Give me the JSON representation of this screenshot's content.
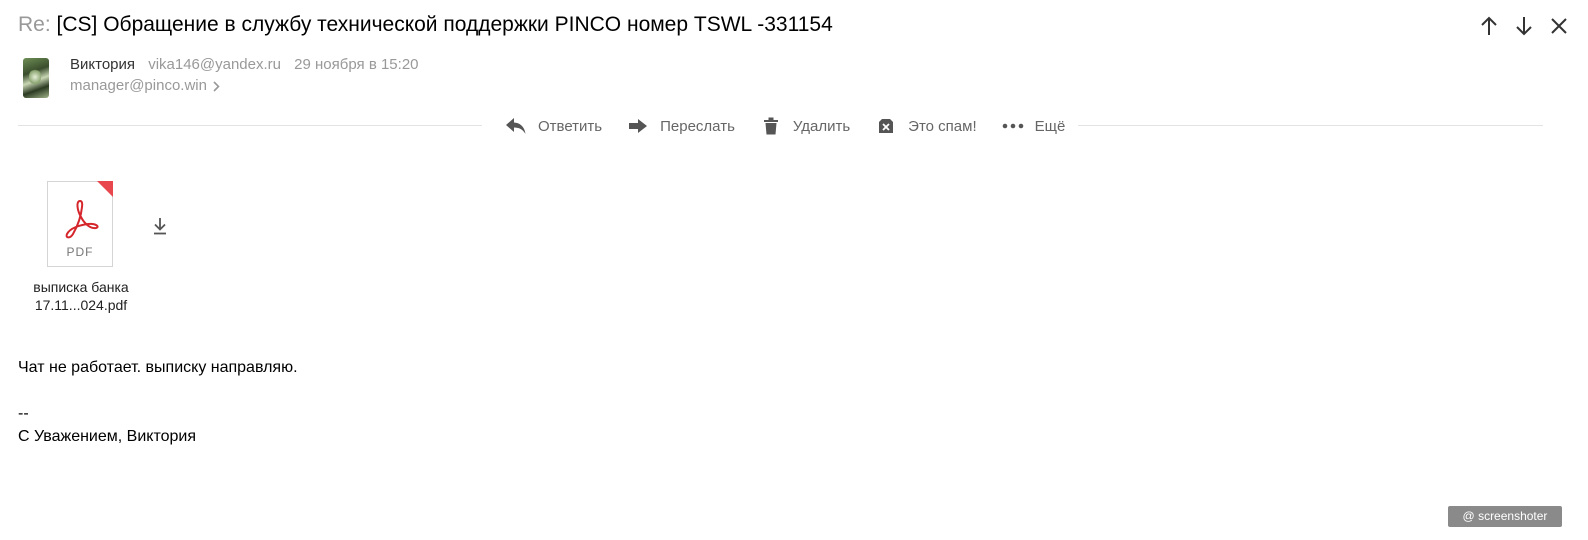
{
  "message": {
    "subject_prefix": "Re:",
    "subject": "[CS] Обращение в службу технической поддержки PINCO номер TSWL -331154",
    "sender_name": "Виктория",
    "sender_email": "vika146@yandex.ru",
    "date": "29 ноября в 15:20",
    "recipient": "manager@pinco.win"
  },
  "nav": {
    "icons": [
      "arrow-up-icon",
      "arrow-down-icon",
      "close-icon"
    ]
  },
  "toolbar": {
    "reply": "Ответить",
    "forward": "Переслать",
    "delete": "Удалить",
    "spam": "Это спам!",
    "more": "Ещё"
  },
  "attachment": {
    "type_label": "PDF",
    "name_line1": "выписка банка",
    "name_line2": "17.11...024.pdf",
    "accent_color": "#e8484d"
  },
  "body": {
    "text": "Чат не работает. выписку направляю.\n\n--\nС Уважением, Виктория"
  },
  "watermark": "@ screenshoter"
}
